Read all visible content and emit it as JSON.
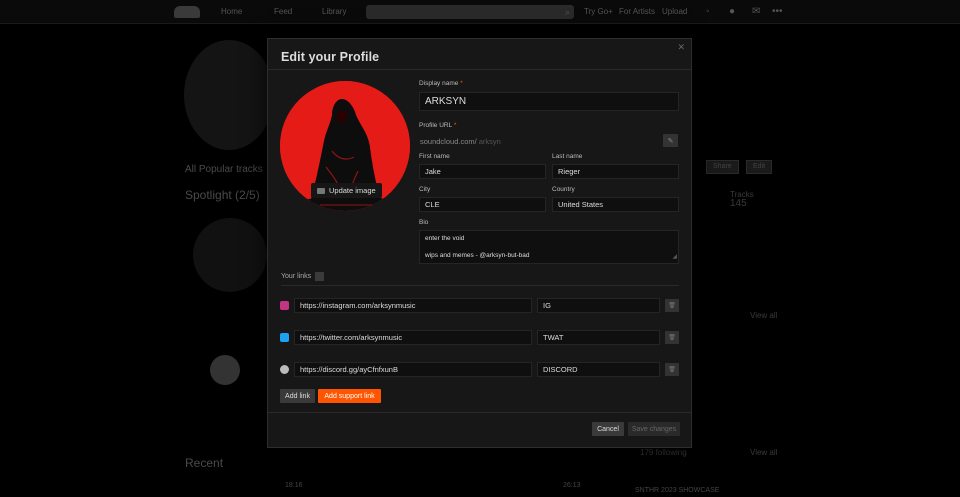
{
  "background": {
    "nav": [
      "Home",
      "Feed",
      "Library"
    ],
    "top_right": [
      "Try Go+",
      "For Artists",
      "Upload"
    ],
    "tabs": "All    Popular tracks",
    "spotlight": "Spotlight (2/5)",
    "recent": "Recent",
    "right_buttons": [
      "Share",
      "Edit"
    ],
    "stats_label": "Tracks",
    "stats_value": "145",
    "view_all": "View all",
    "followers": "179 following",
    "player_time_start": "18:16",
    "player_time_end": "26:13",
    "player_track": "SNTHR 2023 SHOWCASE"
  },
  "modal": {
    "title": "Edit your Profile",
    "close_icon": "close-icon",
    "update_image_label": "Update image",
    "display_name": {
      "label": "Display name",
      "value": "ARKSYN"
    },
    "profile_url": {
      "label": "Profile URL",
      "prefix": "soundcloud.com/",
      "value": "arksyn"
    },
    "first_name": {
      "label": "First name",
      "value": "Jake"
    },
    "last_name": {
      "label": "Last name",
      "value": "Rieger"
    },
    "city": {
      "label": "City",
      "value": "CLE"
    },
    "country": {
      "label": "Country",
      "value": "United States"
    },
    "bio": {
      "label": "Bio",
      "line1": "enter the void",
      "line2": "wips and memes - @arksyn-but-bad"
    },
    "links_label": "Your links",
    "links": [
      {
        "icon": "instagram-icon",
        "color": "#c13584",
        "url": "https://instagram.com/arksynmusic",
        "title": "IG"
      },
      {
        "icon": "twitter-icon",
        "color": "#1da1f2",
        "url": "https://twitter.com/arksynmusic",
        "title": "TWAT"
      },
      {
        "icon": "link-icon",
        "color": "#bbbbbb",
        "url": "https://discord.gg/ayCfnfxunB",
        "title": "DISCORD"
      }
    ],
    "add_link_label": "Add link",
    "add_support_link_label": "Add support link",
    "cancel_label": "Cancel",
    "save_label": "Save changes"
  },
  "colors": {
    "accent": "#ff5500",
    "avatar_bg": "#e41b17"
  }
}
